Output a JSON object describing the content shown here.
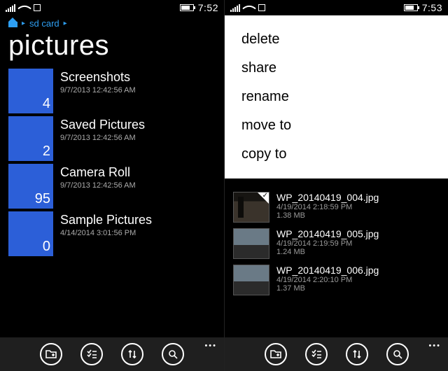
{
  "left": {
    "status": {
      "time": "7:52"
    },
    "breadcrumb": {
      "label": "sd card"
    },
    "title": "pictures",
    "folders": [
      {
        "name": "Screenshots",
        "ts": "9/7/2013 12:42:56 AM",
        "count": "4"
      },
      {
        "name": "Saved Pictures",
        "ts": "9/7/2013 12:42:56 AM",
        "count": "2"
      },
      {
        "name": "Camera Roll",
        "ts": "9/7/2013 12:42:56 AM",
        "count": "95"
      },
      {
        "name": "Sample Pictures",
        "ts": "4/14/2014 3:01:56 PM",
        "count": "0"
      }
    ]
  },
  "right": {
    "status": {
      "time": "7:53"
    },
    "menu": [
      "delete",
      "share",
      "rename",
      "move to",
      "copy to"
    ],
    "files": [
      {
        "name": "WP_20140419_004.jpg",
        "ts": "4/19/2014 2:18:59 PM",
        "size": "1.38 MB"
      },
      {
        "name": "WP_20140419_005.jpg",
        "ts": "4/19/2014 2:19:59 PM",
        "size": "1.24 MB"
      },
      {
        "name": "WP_20140419_006.jpg",
        "ts": "4/19/2014 2:20:10 PM",
        "size": "1.37 MB"
      }
    ]
  },
  "appbar": {
    "new_folder": "new folder",
    "select": "select",
    "sort": "sort",
    "search": "search"
  }
}
